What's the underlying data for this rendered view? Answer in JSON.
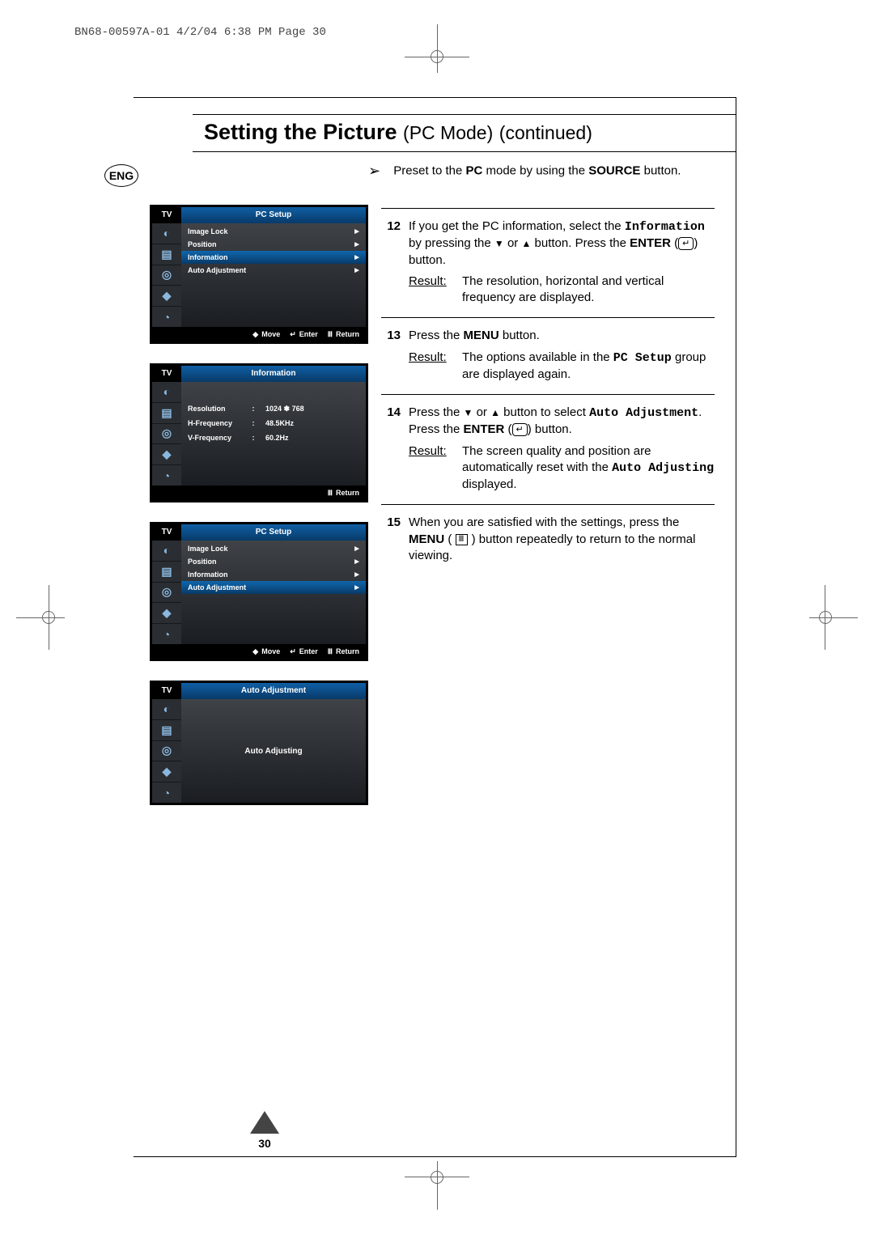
{
  "print_header": "BN68-00597A-01  4/2/04  6:38 PM  Page 30",
  "lang_badge": "ENG",
  "title": {
    "bold": "Setting the Picture",
    "mode": "PC Mode",
    "cont": "(continued)"
  },
  "preset": {
    "pre": "Preset to the ",
    "pc": "PC",
    "mid": " mode by using the ",
    "src": "SOURCE",
    "post": " button."
  },
  "osd1": {
    "tv": "TV",
    "title": "PC Setup",
    "rows": [
      {
        "label": "Image Lock",
        "sel": false
      },
      {
        "label": "Position",
        "sel": false
      },
      {
        "label": "Information",
        "sel": true
      },
      {
        "label": "Auto Adjustment",
        "sel": false
      }
    ],
    "foot": [
      "Move",
      "Enter",
      "Return"
    ]
  },
  "osd2": {
    "tv": "TV",
    "title": "Information",
    "info": [
      {
        "k": "Resolution",
        "v": "1024 ✽ 768"
      },
      {
        "k": "H-Frequency",
        "v": "48.5KHz"
      },
      {
        "k": "V-Frequency",
        "v": "60.2Hz"
      }
    ],
    "foot": [
      "Return"
    ]
  },
  "osd3": {
    "tv": "TV",
    "title": "PC Setup",
    "rows": [
      {
        "label": "Image Lock",
        "sel": false
      },
      {
        "label": "Position",
        "sel": false
      },
      {
        "label": "Information",
        "sel": false
      },
      {
        "label": "Auto Adjustment",
        "sel": true
      }
    ],
    "foot": [
      "Move",
      "Enter",
      "Return"
    ]
  },
  "osd4": {
    "tv": "TV",
    "title": "Auto Adjustment",
    "center": "Auto Adjusting"
  },
  "steps": {
    "s12": {
      "num": "12",
      "l1a": "If you get the PC information, select the ",
      "l1m": "Information",
      "l1b": " by pressing the ",
      "l1c": " or ",
      "l1d": " button. Press the ",
      "l1e": "ENTER",
      "l1f": " button.",
      "result_label": "Result:",
      "result": "The resolution, horizontal and vertical frequency are displayed."
    },
    "s13": {
      "num": "13",
      "l1a": "Press the ",
      "l1b": "MENU",
      "l1c": " button.",
      "result_label": "Result:",
      "result_a": "The options available in the ",
      "result_m": "PC Setup",
      "result_b": " group are displayed again."
    },
    "s14": {
      "num": "14",
      "l1a": "Press the ",
      "l1b": " or ",
      "l1c": " button to select ",
      "l1m": "Auto Adjustment",
      "l1d": ". Press the ",
      "l1e": "ENTER",
      "l1f": " button.",
      "result_label": "Result:",
      "result_a": "The screen quality and position are automatically reset with the ",
      "result_m": "Auto Adjusting",
      "result_b": " displayed."
    },
    "s15": {
      "num": "15",
      "l1a": "When you are satisfied with the settings, press the ",
      "l1b": "MENU",
      "l1c": " button repeatedly to return to the normal viewing."
    }
  },
  "page_number": "30",
  "glyph_arrow_right": "►",
  "glyph_updown": "◆",
  "glyph_enter": "↵",
  "glyph_return": "Ⅲ",
  "glyph_preset_arrow": "➢"
}
